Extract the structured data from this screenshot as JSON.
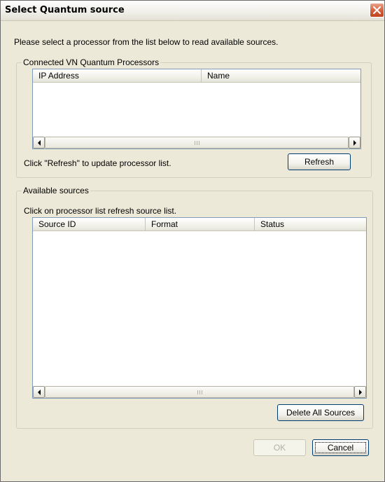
{
  "window": {
    "title": "Select Quantum source"
  },
  "intro_text": "Please select a processor from the list below to read available sources.",
  "processors_group": {
    "label": "Connected VN Quantum Processors",
    "columns": [
      "IP Address",
      "Name"
    ],
    "rows": [],
    "hint": "Click \"Refresh\" to update processor list.",
    "refresh_label": "Refresh"
  },
  "sources_group": {
    "label": "Available sources",
    "hint": "Click on processor list refresh source list.",
    "columns": [
      "Source ID",
      "Format",
      "Status"
    ],
    "rows": [],
    "delete_all_label": "Delete All Sources"
  },
  "buttons": {
    "ok": "OK",
    "cancel": "Cancel"
  },
  "icons": {
    "close": "close-icon",
    "scroll_left": "scroll-left-arrow-icon",
    "scroll_right": "scroll-right-arrow-icon"
  },
  "colors": {
    "close_button": "#d35f3c",
    "dialog_background": "#ece9d8",
    "list_border": "#7f9db9"
  }
}
